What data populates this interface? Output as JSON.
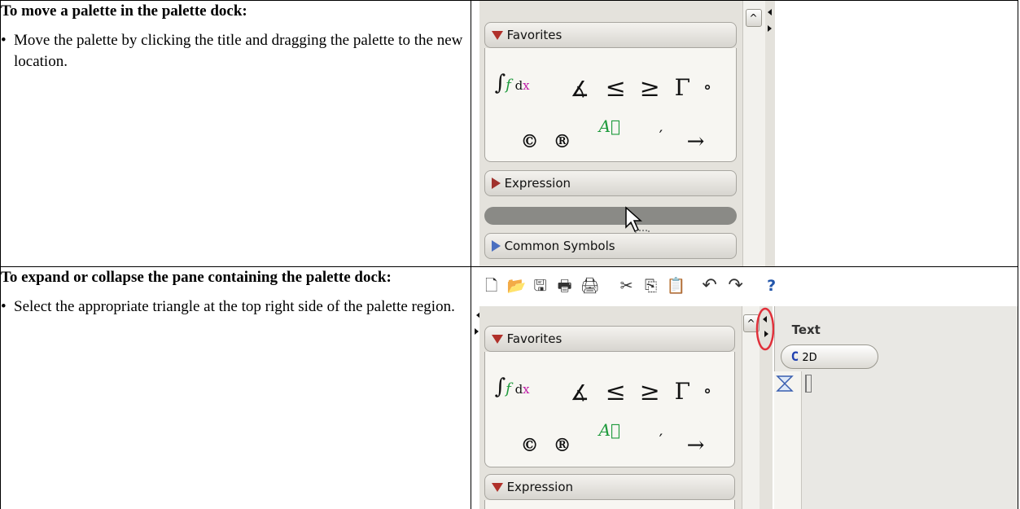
{
  "rows": [
    {
      "title": "To move a palette in the palette dock:",
      "bullet": "Move the palette by clicking the title and dragging the palette to the new location."
    },
    {
      "title": "To expand or collapse the pane containing the palette dock:",
      "bullet": "Select the appropriate triangle at the top right side of the palette region."
    }
  ],
  "bullet_char": "•",
  "screenshot1": {
    "palettes": [
      "Favorites",
      "Expression",
      "Common Symbols"
    ],
    "favorites_symbols_row1": [
      "∫f dx",
      "∡",
      "≤",
      "≥",
      "Γ",
      "∘"
    ],
    "favorites_symbols_row2": [
      "©",
      "®",
      "A⃗",
      "′",
      "→"
    ],
    "scroll_up": "^"
  },
  "screenshot2": {
    "palettes": [
      "Favorites",
      "Expression"
    ],
    "panel_label": "Text",
    "mode_button": "2D",
    "mode_prefix": "C",
    "highlight_color": "#e0303a",
    "toolbar_icons": [
      "new-icon",
      "open-icon",
      "save-icon",
      "print-icon",
      "print-preview-icon",
      "cut-icon",
      "copy-icon",
      "paste-icon",
      "undo-icon",
      "redo-icon"
    ]
  }
}
